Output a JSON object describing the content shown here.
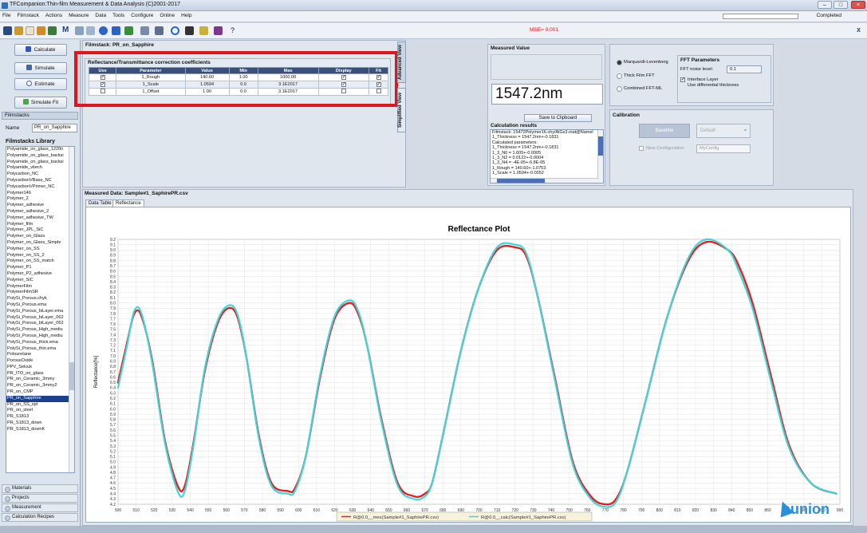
{
  "window": {
    "title": "TFCompanion:Thin-film Measurement & Data Analysis (C)2001-2017",
    "status": "Completed",
    "close_glyph": "x"
  },
  "menu": [
    "File",
    "Filmstack",
    "Actions",
    "Measure",
    "Data",
    "Tools",
    "Configure",
    "Online",
    "Help"
  ],
  "toolbar": {
    "mse": "MSE= 0.001"
  },
  "left": {
    "buttons": {
      "calculate": "Calculate",
      "simulate": "Simulate",
      "estimate": "Estimate",
      "simulate_fit": "Simulate Fit"
    },
    "filmstacks_section": "Filmstacks",
    "name_label": "Name",
    "name_value": "PR_on_Sapphire",
    "library_title": "Filmstacks Library",
    "library": [
      "Polyamide_on_glass_1220n",
      "Polyamide_on_glass_backsi",
      "Polyamide_on_glass_backsi",
      "Polyamide_vitech",
      "Polycarbon_NC",
      "PolycarbonVBase_NC",
      "PolycarbonVPrimer_NC",
      "Polymer146",
      "Polymer_2",
      "Polymer_adhesive",
      "Polymer_adhesive_2",
      "Polymer_adhesive_TW",
      "Polymer_film",
      "Polymer_JPL_SiC",
      "Polymer_on_Glass",
      "Polymer_on_Glass_Simple",
      "Polymer_on_SS",
      "Polymer_on_SS_2",
      "Polymer_on_SS_match",
      "Polymer_P1",
      "Polymer_P2_adhesive",
      "Polymer_SiC",
      "PolymerFilm",
      "PolymerFilmSR",
      "PolySi_Porous.chyk",
      "PolySi_Porous.ema",
      "PolySi_Porous_biLayer.ema",
      "PolySi_Porous_biLayer_062",
      "PolySi_Porous_biLayer_062",
      "PolySi_Porous_High_mediu",
      "PolySi_Porous_High_mediu",
      "PolySi_Porous_thick.ema",
      "PolySi_Porous_thin.ema",
      "Polouretane",
      "PorousOxide",
      "PPV_Selcuk",
      "PR_ITO_on_glass",
      "PR_on_Ceramic_3mmy",
      "PR_on_Ceramic_3mmy2",
      "PR_on_CMP",
      "PR_on_Sapphire",
      "PR_on_SS_spt",
      "PR_on_steel",
      "PR_S1813",
      "PR_S1813_down",
      "PR_S1813_downK"
    ],
    "selected_index": 40,
    "accordion": [
      "Materials",
      "Projects",
      "Measurement",
      "Calculation Recipes"
    ]
  },
  "filmstack": {
    "title": "Filmstack: PR_on_Sapphire",
    "coeff_title": "Reflectance/Transmittance correction coefficients",
    "columns": [
      "Use",
      "Parameter",
      "Value",
      "Min",
      "Max",
      "Display",
      "Fit"
    ],
    "rows": [
      {
        "use": true,
        "parameter": "1_Rough",
        "value": "140.60",
        "min": "1.00",
        "max": "1000.00",
        "display": true,
        "fit": true
      },
      {
        "use": true,
        "parameter": "1_Scale",
        "value": "1.0594",
        "min": "0.0",
        "max": "3.1E2017",
        "display": true,
        "fit": true
      },
      {
        "use": false,
        "parameter": "1_Offset",
        "value": "1.00",
        "min": "0.0",
        "max": "3.1E2017",
        "display": false,
        "fit": false
      }
    ],
    "side_tabs": [
      "Advanced View",
      "Simplified View"
    ]
  },
  "measured": {
    "title": "Measured Value",
    "value": "1547.2nm",
    "clipboard_button": "Save to Clipboard",
    "calc_title": "Calculation results",
    "calc_lines": [
      "Filmstack: 15472Polymer16.chy/AlGs3.mat@Namel",
      "1_Thickness = 1547.2nm+-0.1831",
      "Calculated parameters:",
      "1_Thickness = 1547.2nm+-0.1831",
      "1_3_N0 = 1.605+-0.0005",
      "1_3_N2 = 0.0122+-0.0004",
      "1_3_N4 = -4E-05+-6.8E-05",
      "1_Rough = 140.60+-1.0753",
      "1_Scale = 1.0594+-0.0052"
    ]
  },
  "fit": {
    "options": [
      "Marquardt-Levenberg",
      "Thick Film FFT",
      "Combined FFT-ML"
    ],
    "selected": 0,
    "fft_title": "FFT Parameters",
    "fft_noise_label": "FFT noise level:",
    "fft_noise_value": "0.1",
    "interface_layer": "Interface Layer",
    "use_diff": "Use differential thickness"
  },
  "calibration": {
    "title": "Calibration",
    "button": "Baseline",
    "dropdown": "Default",
    "new_cfg": "New Configuration",
    "cfg_name": "MyConfig"
  },
  "data": {
    "title": "Measured Data: Sample#1_SaphirePR.csv",
    "tabs": [
      "Data Table",
      "Reflectance"
    ],
    "active_tab": 1
  },
  "watermark": {
    "brand": "aunion"
  },
  "chart_data": {
    "type": "line",
    "title": "Reflectance Plot",
    "xlabel": "Wavelength[nm]",
    "ylabel": "Reflectance[%]",
    "xlim": [
      500,
      900
    ],
    "ylim": [
      4.2,
      9.2
    ],
    "x_tick_step": 10,
    "y_tick_step": 0.1,
    "y_tick_labels": [
      "4.2",
      "4.3",
      "4.4",
      "4.5",
      "4.6",
      "4.7",
      "4.8",
      "4.9",
      "5.0",
      "5.1",
      "5.2",
      "5.3",
      "5.4",
      "5.5",
      "5.6",
      "5.7",
      "5.8",
      "5.9",
      "6.0",
      "6.1",
      "6.2",
      "6.3",
      "6.4",
      "6.5",
      "6.6",
      "6.7",
      "6.8",
      "6.9",
      "7.0",
      "7.1",
      "7.2",
      "7.3",
      "7.4",
      "7.5",
      "7.6",
      "7.7",
      "7.8",
      "7.9",
      "8.0",
      "8.1",
      "8.2",
      "8.3",
      "8.4",
      "8.5",
      "8.6",
      "8.7",
      "8.8",
      "8.9",
      "9.0",
      "9.1",
      "9.2"
    ],
    "grid": true,
    "legend_position": "bottom",
    "series": [
      {
        "name": "R@0.0__mes(Sample#1_SaphirePR.csv)",
        "color": "#e32020",
        "style": "dotted-markers",
        "x": [
          500,
          505,
          509,
          513,
          519,
          526,
          533,
          537,
          542,
          548,
          555,
          561,
          566,
          571,
          578,
          585,
          594,
          598,
          604,
          612,
          620,
          628,
          633,
          638,
          646,
          655,
          664,
          670,
          674,
          680,
          690,
          700,
          710,
          720,
          726,
          732,
          742,
          752,
          762,
          770,
          776,
          782,
          792,
          804,
          816,
          826,
          838,
          844,
          852,
          862,
          872,
          884,
          898
        ],
        "y": [
          6.5,
          7.25,
          7.8,
          7.75,
          6.9,
          5.4,
          4.55,
          4.55,
          5.4,
          6.7,
          7.6,
          7.9,
          7.75,
          7.0,
          5.5,
          4.6,
          4.45,
          4.5,
          5.1,
          6.6,
          7.7,
          8.0,
          7.8,
          7.2,
          5.8,
          4.6,
          4.35,
          4.4,
          4.6,
          5.5,
          7.1,
          8.3,
          9.0,
          9.05,
          8.9,
          8.2,
          6.6,
          5.0,
          4.35,
          4.2,
          4.3,
          4.8,
          6.1,
          7.7,
          8.8,
          9.15,
          9.0,
          8.7,
          7.95,
          6.6,
          5.3,
          4.6,
          4.4
        ]
      },
      {
        "name": "R@0.0__calc(Sample#1_SaphirePR.csv)",
        "color": "#3fd6db",
        "style": "solid",
        "x": [
          500,
          505,
          509,
          513,
          519,
          526,
          533,
          537,
          542,
          548,
          555,
          561,
          566,
          571,
          578,
          585,
          594,
          598,
          604,
          612,
          620,
          628,
          633,
          638,
          646,
          655,
          664,
          670,
          674,
          680,
          690,
          700,
          710,
          720,
          726,
          732,
          742,
          752,
          762,
          770,
          776,
          782,
          792,
          804,
          816,
          826,
          838,
          844,
          852,
          862,
          872,
          884,
          898
        ],
        "y": [
          6.4,
          7.2,
          7.85,
          7.8,
          6.85,
          5.35,
          4.45,
          4.45,
          5.35,
          6.75,
          7.65,
          7.95,
          7.8,
          7.0,
          5.45,
          4.55,
          4.4,
          4.45,
          5.1,
          6.65,
          7.75,
          8.05,
          7.85,
          7.2,
          5.75,
          4.55,
          4.3,
          4.35,
          4.6,
          5.5,
          7.1,
          8.3,
          9.05,
          9.1,
          8.95,
          8.2,
          6.55,
          4.95,
          4.3,
          4.15,
          4.25,
          4.8,
          6.1,
          7.7,
          8.85,
          9.2,
          9.0,
          8.6,
          7.85,
          6.5,
          5.25,
          4.6,
          4.4
        ]
      }
    ]
  }
}
